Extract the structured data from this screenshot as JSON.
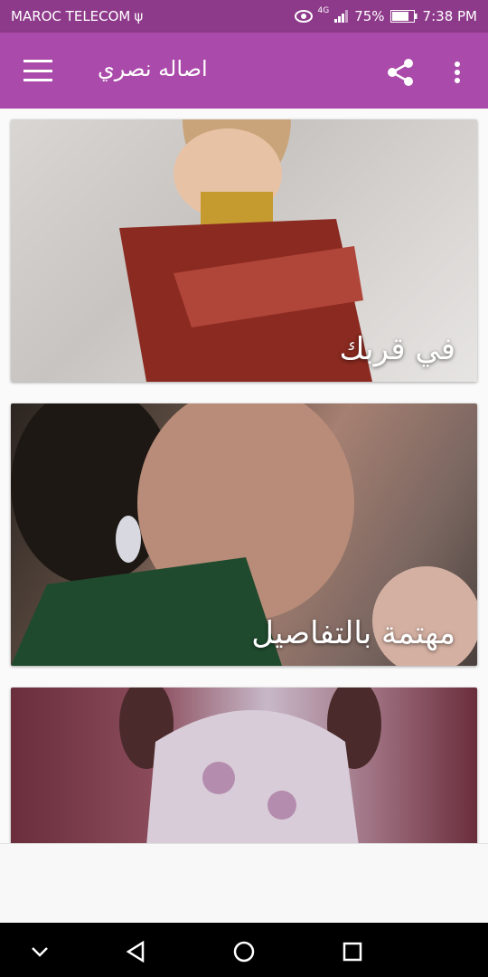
{
  "status_bar": {
    "carrier": "MAROC TELECOM",
    "usb_icon": "usb-icon",
    "eye_icon": "eye-icon",
    "network": "4G",
    "battery_percent": "75%",
    "time": "7:38 PM"
  },
  "app_bar": {
    "title": "اصاله نصري",
    "menu_icon": "hamburger-menu-icon",
    "share_icon": "share-icon",
    "more_icon": "more-vert-icon",
    "color": "#aa4aaa"
  },
  "cards": [
    {
      "caption": "في قربك"
    },
    {
      "caption": "مهتمة بالتفاصيل"
    },
    {
      "caption": ""
    }
  ],
  "nav_bar": {
    "collapse_icon": "chevron-down-icon",
    "back_icon": "back-triangle-icon",
    "home_icon": "home-circle-icon",
    "recents_icon": "recents-square-icon"
  }
}
